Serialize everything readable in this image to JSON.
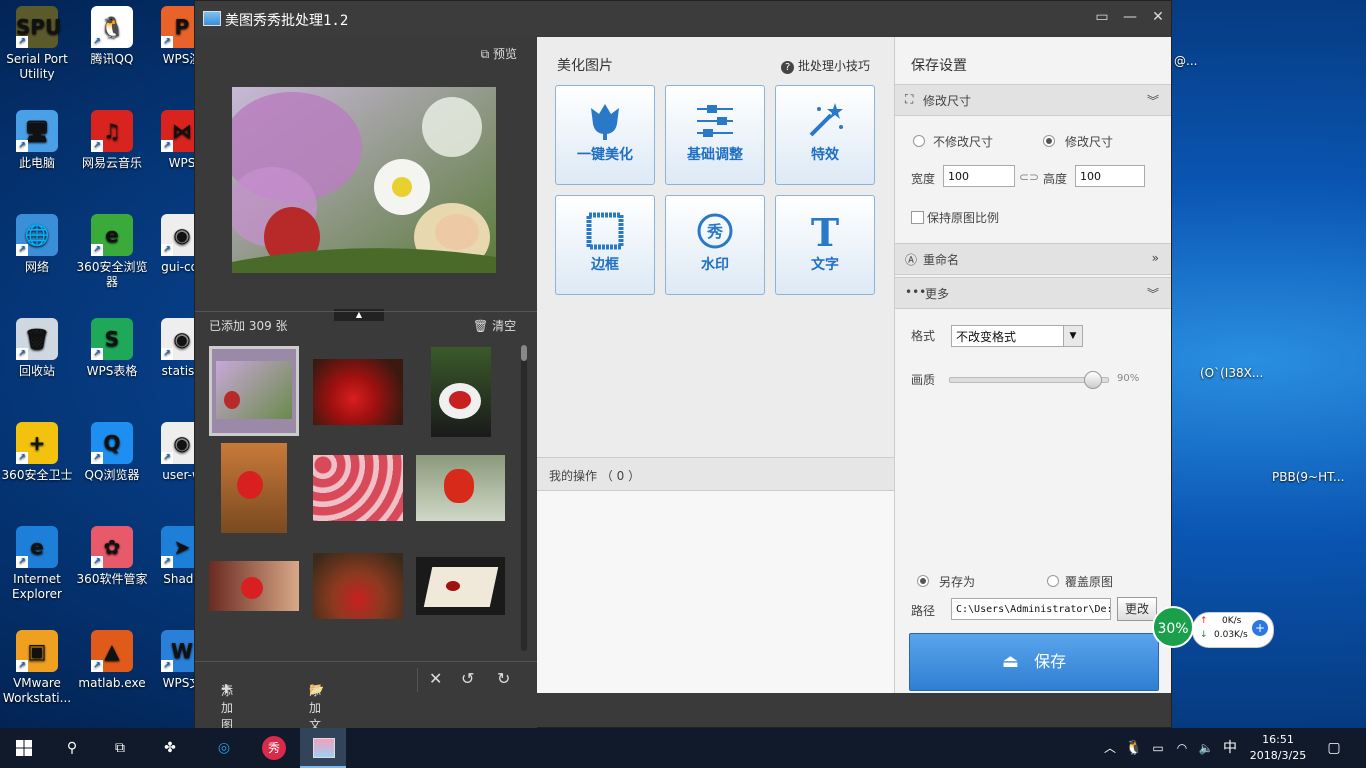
{
  "desktop": {
    "icons": [
      {
        "label": "Serial Port Utility",
        "glyph": "SPU",
        "color": "#5a5a2a"
      },
      {
        "label": "腾讯QQ",
        "glyph": "🐧",
        "color": "#ffffff"
      },
      {
        "label": "WPS演",
        "glyph": "P",
        "color": "#e8622a"
      },
      {
        "label": "此电脑",
        "glyph": "🖥",
        "color": "#4aa0e6"
      },
      {
        "label": "网易云音乐",
        "glyph": "♫",
        "color": "#d8231f"
      },
      {
        "label": "WPS",
        "glyph": "⋈",
        "color": "#d8231f"
      },
      {
        "label": "网络",
        "glyph": "🌐",
        "color": "#3a8fd8"
      },
      {
        "label": "360安全浏览器",
        "glyph": "e",
        "color": "#3aaa3a"
      },
      {
        "label": "gui-cor",
        "glyph": "◉",
        "color": "#eeeeee"
      },
      {
        "label": "回收站",
        "glyph": "🗑",
        "color": "#cfd8e0"
      },
      {
        "label": "WPS表格",
        "glyph": "S",
        "color": "#1fa85a"
      },
      {
        "label": "statisti",
        "glyph": "◉",
        "color": "#eeeeee"
      },
      {
        "label": "360安全卫士",
        "glyph": "+",
        "color": "#f2c20f"
      },
      {
        "label": "QQ浏览器",
        "glyph": "Q",
        "color": "#1e8ff0"
      },
      {
        "label": "user-w",
        "glyph": "◉",
        "color": "#eeeeee"
      },
      {
        "label": "Internet Explorer",
        "glyph": "e",
        "color": "#1e7fd8"
      },
      {
        "label": "360软件管家",
        "glyph": "✿",
        "color": "#e85a6a"
      },
      {
        "label": "Shado",
        "glyph": "➤",
        "color": "#1e7fd8"
      },
      {
        "label": "VMware Workstati...",
        "glyph": "▣",
        "color": "#f0a020"
      },
      {
        "label": "matlab.exe",
        "glyph": "▲",
        "color": "#e05a1a"
      },
      {
        "label": "WPS文",
        "glyph": "W",
        "color": "#2a7fd8"
      }
    ],
    "right_icons": [
      {
        "label": "@..."
      },
      {
        "label": "(O`(I38X..."
      },
      {
        "label": "PBB(9~HT..."
      }
    ]
  },
  "window": {
    "title": "美图秀秀批处理1.2",
    "controls": [
      "▭",
      "—",
      "✕"
    ],
    "preview_label": "预览",
    "added_label": "已添加 309 张",
    "clear_label": "清空",
    "add_image_label": "添加图片",
    "add_folder_label": "添加文件夹"
  },
  "beautify": {
    "header": "美化图片",
    "tips_label": "批处理小技巧",
    "tools": [
      {
        "name": "one-click-beautify",
        "label": "一键美化",
        "icon": "tulip-icon"
      },
      {
        "name": "basic-adjust",
        "label": "基础调整",
        "icon": "sliders-icon"
      },
      {
        "name": "effects",
        "label": "特效",
        "icon": "magic-wand-icon"
      },
      {
        "name": "border",
        "label": "边框",
        "icon": "frame-icon"
      },
      {
        "name": "watermark",
        "label": "水印",
        "icon": "watermark-icon"
      },
      {
        "name": "text",
        "label": "文字",
        "icon": "text-icon"
      }
    ],
    "ops_label": "我的操作 （ 0 ）"
  },
  "save_settings": {
    "header": "保存设置",
    "resize_section": "修改尺寸",
    "no_resize_label": "不修改尺寸",
    "resize_label": "修改尺寸",
    "width_label": "宽度",
    "width_value": "100",
    "height_label": "高度",
    "height_value": "100",
    "keep_ratio_label": "保持原图比例",
    "rename_section": "重命名",
    "more_section": "更多",
    "format_label": "格式",
    "format_value": "不改变格式",
    "quality_label": "画质",
    "quality_value": "90%",
    "quality_fraction": 0.9,
    "save_as_label": "另存为",
    "overwrite_label": "覆盖原图",
    "path_label": "路径",
    "path_value": "C:\\Users\\Administrator\\De:",
    "change_label": "更改",
    "save_label": "保存"
  },
  "net_widget": {
    "percent": "30%",
    "up": "0K/s",
    "down": "0.03K/s"
  },
  "taskbar": {
    "ime": "中",
    "time": "16:51",
    "date": "2018/3/25"
  }
}
